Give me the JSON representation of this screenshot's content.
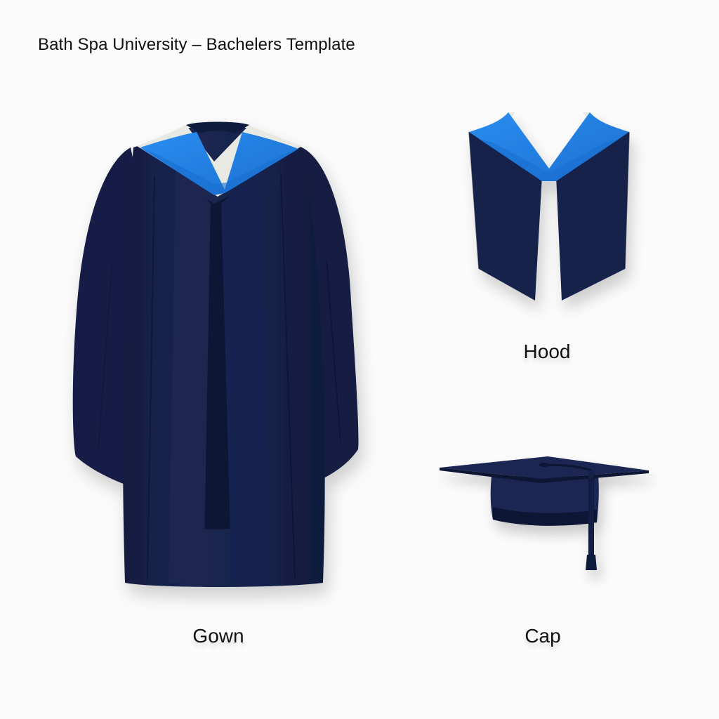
{
  "page": {
    "title": "Bath Spa University – Bachelers Template"
  },
  "items": {
    "gown": {
      "label": "Gown"
    },
    "hood": {
      "label": "Hood"
    },
    "cap": {
      "label": "Cap"
    }
  },
  "colors": {
    "navy": "#17224a",
    "navy_dark": "#0e1633",
    "hood_blue": "#1f7fe0",
    "hood_white": "#e9e9e4",
    "background": "#fbfbfb"
  },
  "icons": {
    "gown": "academic-gown-icon",
    "hood": "academic-hood-icon",
    "cap": "mortarboard-cap-icon"
  }
}
